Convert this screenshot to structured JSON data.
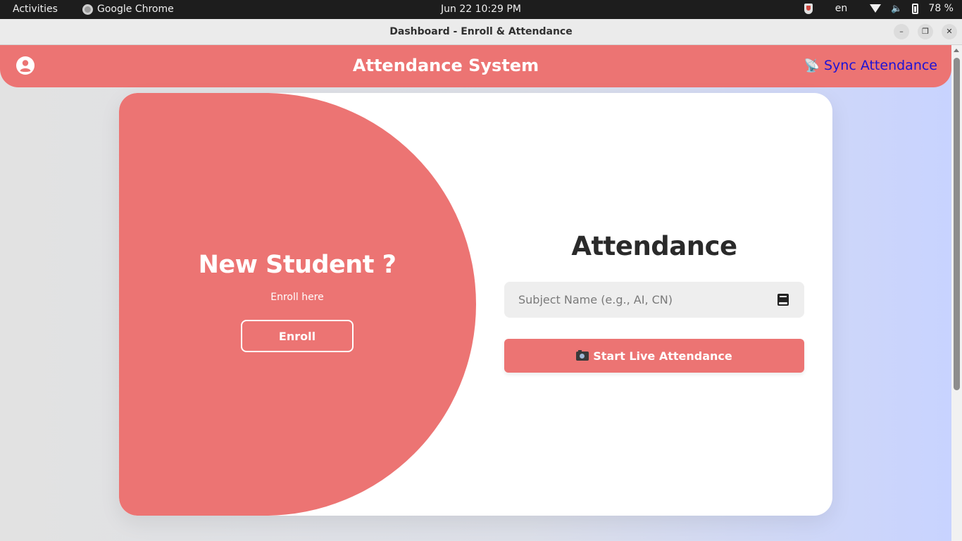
{
  "system_bar": {
    "activities": "Activities",
    "app_name": "Google Chrome",
    "clock": "Jun 22  10:29 PM",
    "language": "en",
    "battery": "78 %"
  },
  "window": {
    "title": "Dashboard - Enroll & Attendance"
  },
  "header": {
    "title": "Attendance System",
    "sync_label": "Sync Attendance",
    "sync_icon": "📡"
  },
  "enroll_panel": {
    "heading": "New Student ?",
    "subtext": "Enroll here",
    "button_label": "Enroll"
  },
  "attendance_panel": {
    "heading": "Attendance",
    "subject_placeholder": "Subject Name (e.g., AI, CN)",
    "subject_value": "",
    "start_button_label": "Start Live Attendance"
  },
  "colors": {
    "accent": "#ec7473",
    "link": "#1d13d6",
    "card_bg": "#ffffff"
  }
}
